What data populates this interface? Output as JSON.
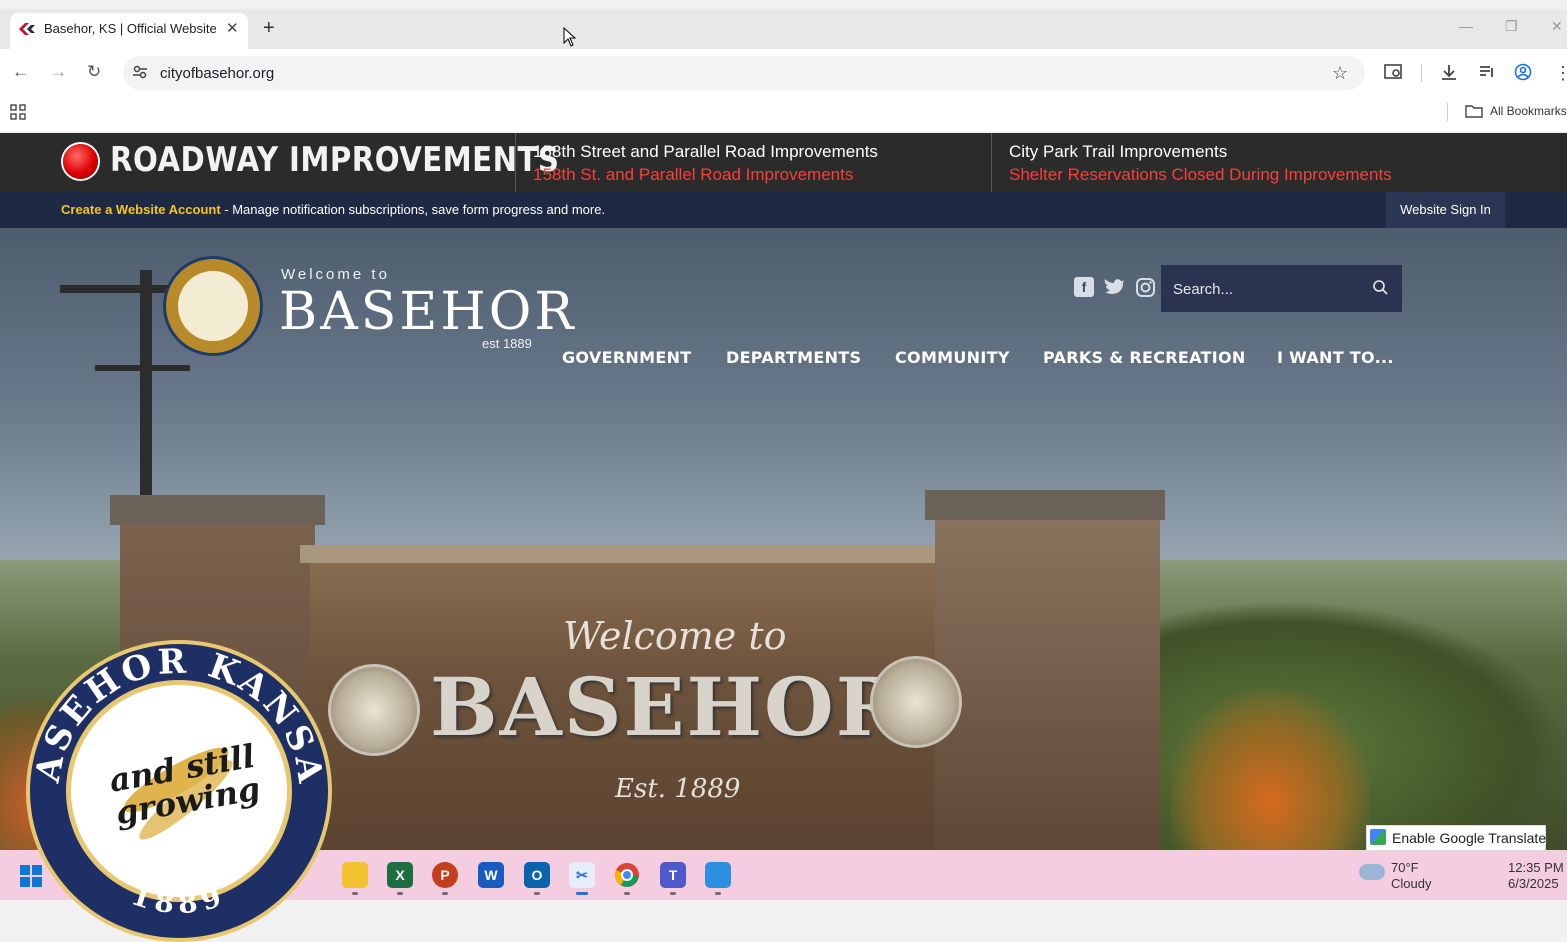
{
  "browser": {
    "tab_title": "Basehor, KS | Official Website",
    "url": "cityofbasehor.org",
    "bookmarks_label": "All Bookmarks"
  },
  "alert_bar": {
    "title": "ROADWAY IMPROVEMENTS",
    "items": [
      {
        "heading": "158th Street and Parallel Road Improvements",
        "link": "158th St. and Parallel Road Improvements"
      },
      {
        "heading": "City Park Trail Improvements",
        "link": "Shelter Reservations Closed During Improvements"
      }
    ]
  },
  "account_bar": {
    "link": "Create a Website Account",
    "text": " - Manage notification subscriptions, save form progress and more.",
    "sign_in": "Website Sign In"
  },
  "header": {
    "welcome": "Welcome to",
    "city": "BASEHOR",
    "est": "est 1889",
    "search_placeholder": "Search..."
  },
  "nav": [
    "GOVERNMENT",
    "DEPARTMENTS",
    "COMMUNITY",
    "PARKS & RECREATION",
    "I WANT TO..."
  ],
  "sign": {
    "welcome": "Welcome to",
    "name": "BASEHOR",
    "est": "Est. 1889"
  },
  "seal": {
    "ring_text": "BASEHOR KANSAS",
    "year": "1889",
    "motto": "and still growing"
  },
  "translate": {
    "label": "Enable Google Translate"
  },
  "taskbar": {
    "temp": "70°F",
    "condition": "Cloudy",
    "time": "12:35 PM",
    "date": "6/3/2025"
  },
  "colors": {
    "alert_bg": "#2b2b2b",
    "alert_link": "#ff3b3b",
    "account_bar": "#1e2a44",
    "account_link": "#f5c518",
    "taskbar": "#f4cde0"
  }
}
